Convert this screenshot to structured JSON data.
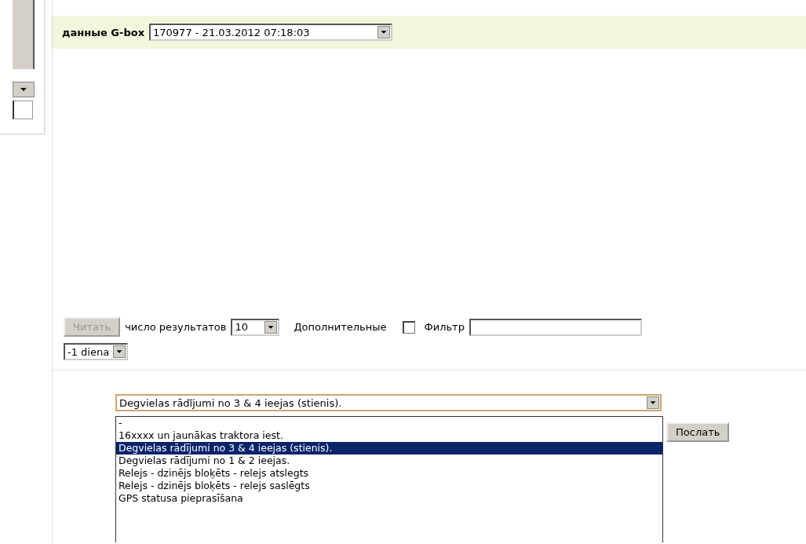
{
  "header": {
    "label": "данные G-box",
    "record_select": {
      "value": "170977 - 21.03.2012 07:18:03"
    }
  },
  "controls": {
    "read_button": {
      "label": "Читать",
      "disabled": true
    },
    "results_label": "число результатов",
    "results_select": {
      "value": "10"
    },
    "extra_label": "Дополнительные",
    "extra_checkbox": {
      "checked": false
    },
    "filter_label": "Фильтр",
    "period_select": {
      "value": "-1 diena"
    }
  },
  "command": {
    "select": {
      "value": "Degvielas rādījumi no 3 & 4 ieejas (stienis).",
      "expanded": true
    },
    "options": [
      {
        "label": "-",
        "selected": false
      },
      {
        "label": "16xxxx un jaunākas traktora iest.",
        "selected": false
      },
      {
        "label": "Degvielas rādījumi no 3 & 4 ieejas (stienis).",
        "selected": true
      },
      {
        "label": "Degvielas rādījumi no 1 & 2 ieejas.",
        "selected": false
      },
      {
        "label": "Relejs - dzinējs bloķēts - relejs atslegts",
        "selected": false
      },
      {
        "label": "Relejs - dzinējs bloķēts - relejs saslēgts",
        "selected": false
      },
      {
        "label": "GPS statusa pieprasīšana",
        "selected": false
      }
    ],
    "send_button": {
      "label": "Послать"
    }
  }
}
